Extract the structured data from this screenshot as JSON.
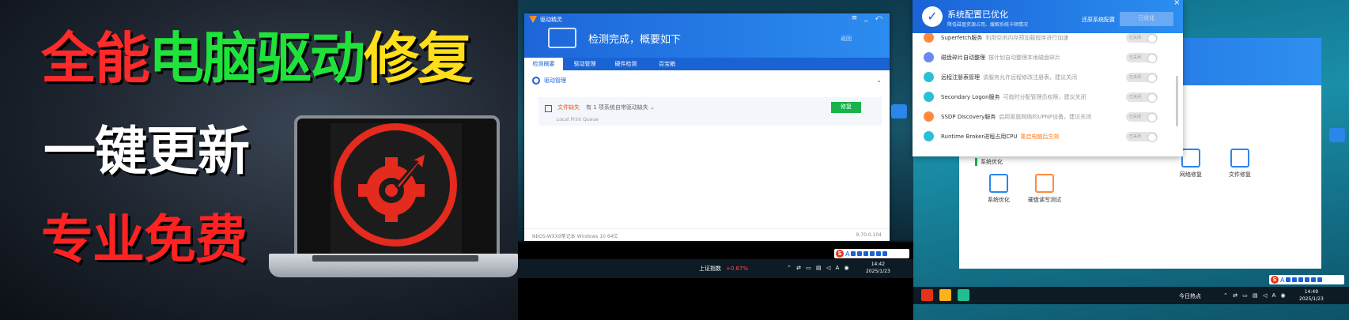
{
  "banner": {
    "line1": [
      "全能",
      "电脑驱动",
      "修复"
    ],
    "line2": "一键更新",
    "line3": "专业免费"
  },
  "middle": {
    "app_title": "驱动精灵",
    "window_controls": "≡ _ ⤺",
    "scan_title": "检测完成，概要如下",
    "back_link": "返回",
    "tabs": [
      "检测概要",
      "驱动管理",
      "硬件检测",
      "百宝箱"
    ],
    "section_label": "驱动管理",
    "item": {
      "status": "文件缺失",
      "desc": "有 1 项系统自带驱动缺失  ⌄",
      "sub": "Local Print Queue",
      "button": "修复"
    },
    "footer_left": "NbOS-WXX9笔记本    Windows 10 64位",
    "footer_right": "9.70.0.104",
    "taskbar": {
      "stock_label": "上证指数",
      "stock_change": "+0.67%",
      "time": "14:42",
      "date": "2025/1/23"
    }
  },
  "right": {
    "popup": {
      "title": "系统配置已优化",
      "subtitle": "降低磁盘资源占用、缓解系统卡顿情况",
      "restore_link": "还原系统配置",
      "button": "已优化",
      "close": "×",
      "items": [
        {
          "name": "Superfetch服务",
          "desc": "利用空闲内存预加载程序进行加速",
          "warn": false,
          "color": "#ff8a3d",
          "toggle": "已关闭"
        },
        {
          "name": "磁盘碎片自动整理",
          "desc": "按计划自动整理本地磁盘碎片",
          "warn": false,
          "color": "#6a8af0",
          "toggle": "已关闭"
        },
        {
          "name": "远程注册表管理",
          "desc": "该服务允许远程修改注册表，建议关闭",
          "warn": false,
          "color": "#2bbfd6",
          "toggle": "已关闭"
        },
        {
          "name": "Secondary Logon服务",
          "desc": "可临时分配管理员权限，建议关闭",
          "warn": false,
          "color": "#2bbfd6",
          "toggle": "已关闭"
        },
        {
          "name": "SSDP Discovery服务",
          "desc": "启用家庭网络的UPNP设备，建议关闭",
          "warn": false,
          "color": "#ff8a3d",
          "toggle": "已关闭"
        },
        {
          "name": "Runtime Broker进程占用CPU",
          "desc": "重启电脑后生效",
          "warn": true,
          "color": "#2bbfd6",
          "toggle": "已关闭"
        }
      ]
    },
    "tools": [
      "网络修复",
      "文件修复"
    ],
    "section": "系统优化",
    "sub_tools": [
      "系统优化",
      "硬盘读写测试"
    ],
    "taskbar": {
      "news": "今日热点",
      "time": "14:49",
      "date": "2025/1/23"
    }
  }
}
